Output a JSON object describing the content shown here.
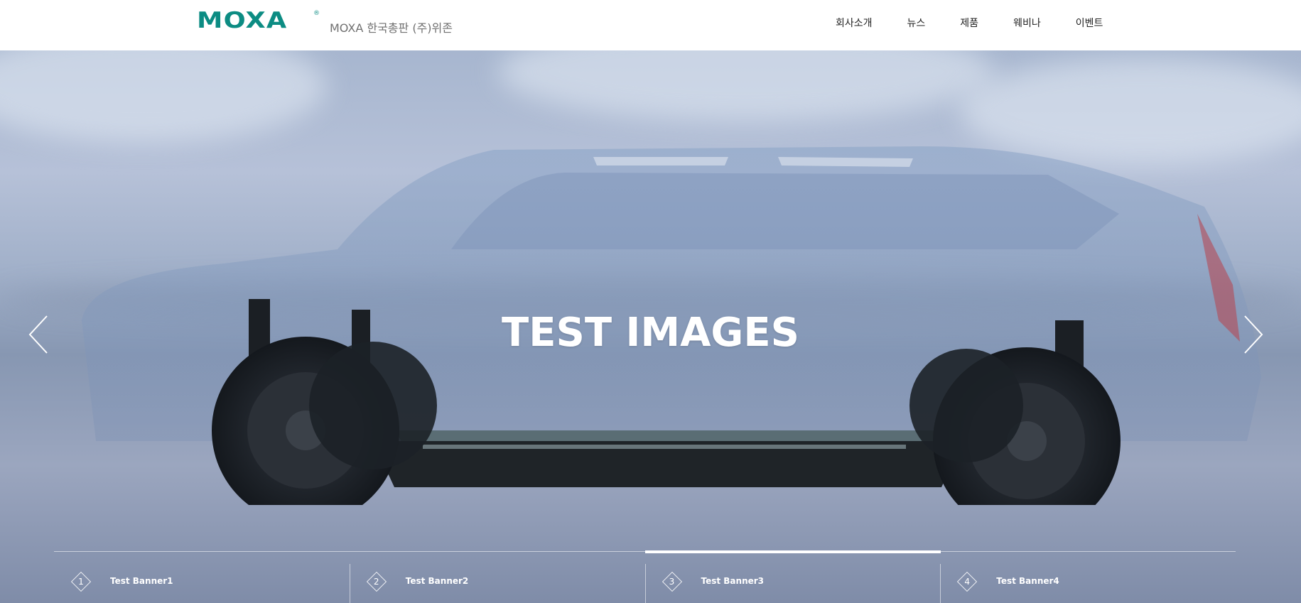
{
  "header": {
    "logo_text": "MOXA",
    "logo_registered": "®",
    "subtitle": "MOXA 한국총판 (주)위존",
    "nav": [
      {
        "label": "회사소개"
      },
      {
        "label": "뉴스"
      },
      {
        "label": "제품"
      },
      {
        "label": "웨비나"
      },
      {
        "label": "이벤트"
      }
    ]
  },
  "hero": {
    "title": "TEST IMAGES",
    "prev_icon": "chevron-left-icon",
    "next_icon": "chevron-right-icon",
    "active_banner_index": 2,
    "banners": [
      {
        "number": "1",
        "label": "Test Banner1"
      },
      {
        "number": "2",
        "label": "Test Banner2"
      },
      {
        "number": "3",
        "label": "Test Banner3"
      },
      {
        "number": "4",
        "label": "Test Banner4"
      }
    ]
  },
  "colors": {
    "brand": "#0c8c83",
    "nav_text": "#222222",
    "subtitle": "#707070",
    "hero_text": "#ffffff"
  }
}
